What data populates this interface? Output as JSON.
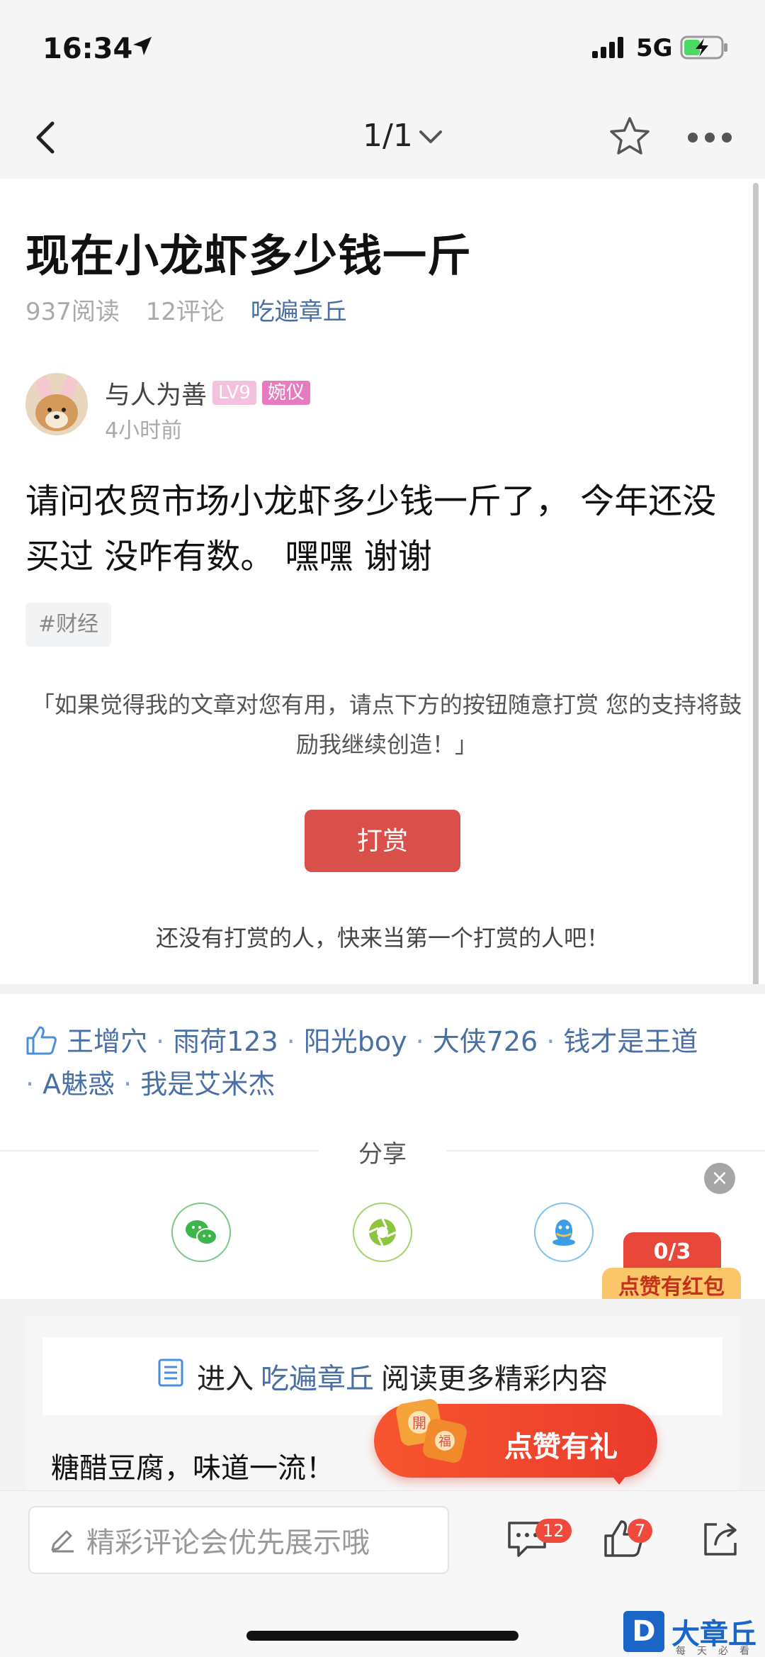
{
  "status_bar": {
    "time": "16:34",
    "network": "5G"
  },
  "nav": {
    "pager": "1/1"
  },
  "article": {
    "title": "现在小龙虾多少钱一斤",
    "read_count": "937阅读",
    "comment_count": "12评论",
    "category": "吃遍章丘",
    "author": {
      "name": "与人为善",
      "level": "LV9",
      "role": "婉仪",
      "posted": "4小时前"
    },
    "body": "请问农贸市场小龙虾多少钱一斤了， 今年还没买过 没咋有数。 嘿嘿 谢谢",
    "tag": "#财经"
  },
  "tip": {
    "note": "「如果觉得我的文章对您有用，请点下方的按钮随意打赏 您的支持将鼓励我继续创造！」",
    "button": "打赏",
    "empty": "还没有打赏的人，快来当第一个打赏的人吧！"
  },
  "likers": [
    "王增穴",
    "雨荷123",
    "阳光boy",
    "大侠726",
    "钱才是王道",
    "A魅惑",
    "我是艾米杰"
  ],
  "share": {
    "label": "分享",
    "close": "×"
  },
  "red_packet": {
    "count": "0/3",
    "label": "点赞有红包"
  },
  "recommend": {
    "prefix": "进入",
    "category": "吃遍章丘",
    "suffix": "阅读更多精彩内容",
    "item": "糖醋豆腐，味道一流！"
  },
  "promo": {
    "label": "点赞有礼",
    "gift_text_1": "開",
    "gift_text_2": "福"
  },
  "bottom_bar": {
    "comment_placeholder": "精彩评论会优先展示哦",
    "comment_count": "12",
    "like_count": "7"
  },
  "watermark": {
    "logo": "D",
    "name": "大章丘",
    "slogan": "每天必看"
  },
  "colors": {
    "accent_blue": "#4a6fa5",
    "tip_red": "#d9504a",
    "badge_red": "#ef4a3c"
  }
}
